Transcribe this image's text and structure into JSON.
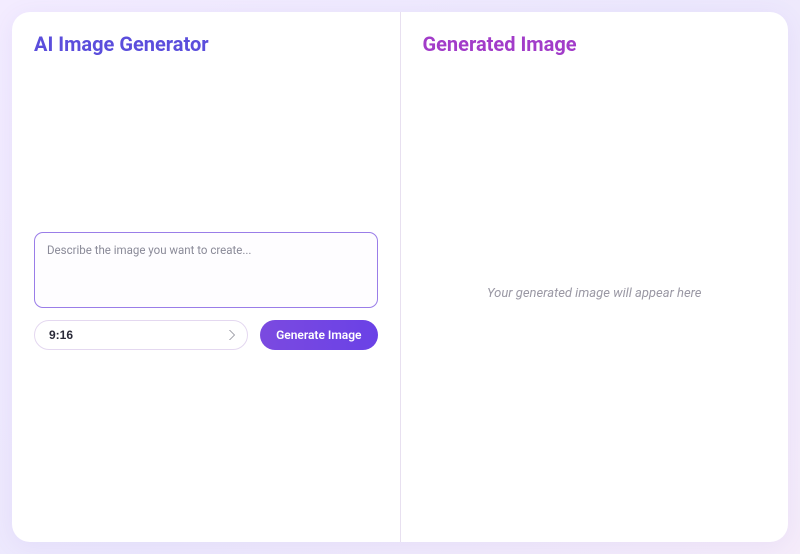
{
  "left_panel": {
    "title": "AI Image Generator",
    "prompt_placeholder": "Describe the image you want to create...",
    "prompt_value": "",
    "aspect_selected": "9:16",
    "generate_label": "Generate Image"
  },
  "right_panel": {
    "title": "Generated Image",
    "placeholder_text": "Your generated image will appear here"
  }
}
